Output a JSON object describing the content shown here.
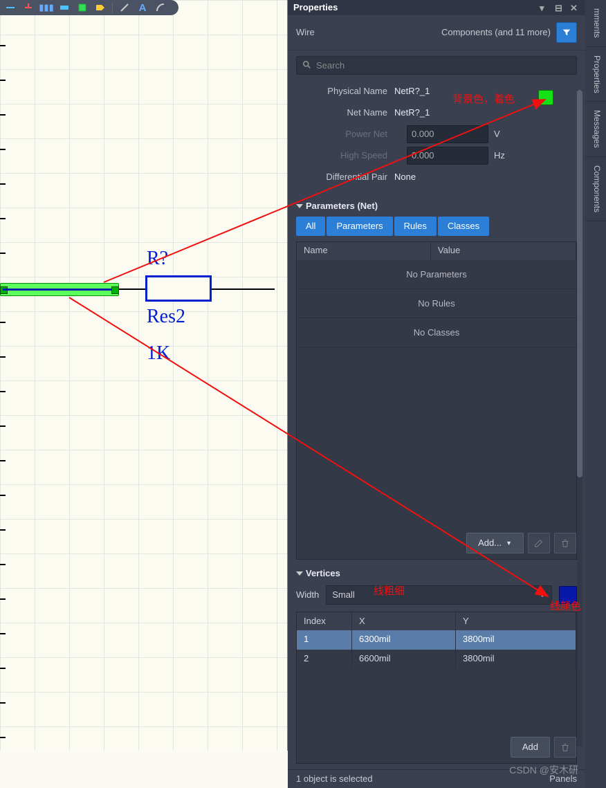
{
  "panel": {
    "title": "Properties",
    "type": "Wire",
    "filter": "Components (and 11 more)",
    "search_placeholder": "Search"
  },
  "fields": {
    "physical_name": {
      "label": "Physical Name",
      "value": "NetR?_1"
    },
    "net_name": {
      "label": "Net Name",
      "value": "NetR?_1"
    },
    "power_net": {
      "label": "Power Net",
      "value": "0.000",
      "unit": "V"
    },
    "high_speed": {
      "label": "High Speed",
      "value": "0.000",
      "unit": "Hz"
    },
    "diff_pair": {
      "label": "Differential Pair",
      "value": "None"
    },
    "bg_color": "#15e015"
  },
  "section_params": "Parameters (Net)",
  "pbuttons": {
    "all": "All",
    "params": "Parameters",
    "rules": "Rules",
    "classes": "Classes"
  },
  "ptable": {
    "hname": "Name",
    "hvalue": "Value",
    "noparams": "No Parameters",
    "norules": "No Rules",
    "noclasses": "No Classes",
    "add": "Add..."
  },
  "section_vertices": "Vertices",
  "width": {
    "label": "Width",
    "value": "Small",
    "line_color": "#0818a8"
  },
  "vtable": {
    "headers": {
      "index": "Index",
      "x": "X",
      "y": "Y"
    },
    "rows": [
      {
        "index": "1",
        "x": "6300mil",
        "y": "3800mil"
      },
      {
        "index": "2",
        "x": "6600mil",
        "y": "3800mil"
      }
    ],
    "add": "Add"
  },
  "status": {
    "selected": "1 object is selected",
    "panels": "Panels"
  },
  "sidetabs": {
    "comments": "mments",
    "properties": "Properties",
    "messages": "Messages",
    "components": "Components"
  },
  "schematic": {
    "designator": "R?",
    "comment": "Res2",
    "value": "1K"
  },
  "annotations": {
    "bgcolor": "背景色，着色",
    "thickness": "线粗细",
    "linecolor": "线颜色"
  },
  "watermark": "CSDN @安木研"
}
